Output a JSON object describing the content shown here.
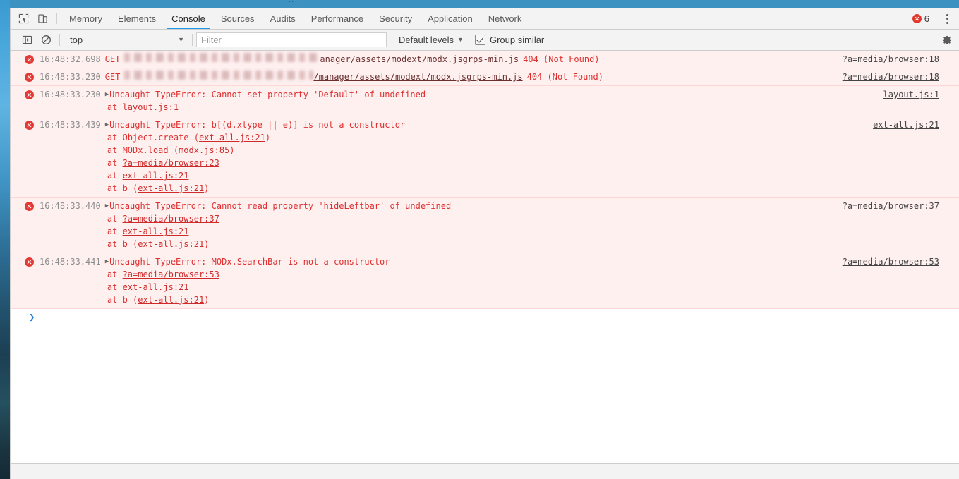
{
  "window": {
    "browser_titlebar_ghost_text": "…",
    "accent_blue": "#1a9bf0",
    "error_red": "#e53935",
    "message_bg": "#fff0f0"
  },
  "tabbar": {
    "icons": [
      {
        "name": "inspect-element-icon",
        "title": "Inspect element"
      },
      {
        "name": "device-toolbar-icon",
        "title": "Toggle device toolbar"
      }
    ],
    "tabs": [
      {
        "label": "Memory",
        "active": false
      },
      {
        "label": "Elements",
        "active": false
      },
      {
        "label": "Console",
        "active": true
      },
      {
        "label": "Sources",
        "active": false
      },
      {
        "label": "Audits",
        "active": false
      },
      {
        "label": "Performance",
        "active": false
      },
      {
        "label": "Security",
        "active": false
      },
      {
        "label": "Application",
        "active": false
      },
      {
        "label": "Network",
        "active": false
      }
    ],
    "error_count": "6",
    "more_menu": "⋮"
  },
  "filterbar": {
    "sidebar_toggle_icon": "console-sidebar-icon",
    "clear_icon": "clear-console-icon",
    "context": "top",
    "context_caret": "▼",
    "filter_placeholder": "Filter",
    "filter_value": "",
    "levels_label": "Default levels",
    "levels_caret": "▼",
    "group_similar_label": "Group similar",
    "group_similar_checked": true,
    "settings_icon": "gear-icon"
  },
  "console": {
    "messages": [
      {
        "id": "msg-1",
        "level": "error",
        "timestamp": "16:48:32.698",
        "expandable": false,
        "method": "GET",
        "url_redacted": true,
        "url_redacted_width": 277,
        "url_tail": "anager/assets/modext/modx.jsgrps-min.js",
        "status": "404 (Not Found)",
        "source_link": "?a=media/browser:18",
        "stack": []
      },
      {
        "id": "msg-2",
        "level": "error",
        "timestamp": "16:48:33.230",
        "expandable": false,
        "method": "GET",
        "url_redacted": true,
        "url_redacted_width": 268,
        "url_tail": "/manager/assets/modext/modx.jsgrps-min.js",
        "status": "404 (Not Found)",
        "source_link": "?a=media/browser:18",
        "stack": []
      },
      {
        "id": "msg-3",
        "level": "error",
        "timestamp": "16:48:33.230",
        "expandable": true,
        "triangle": "▶",
        "text": "Uncaught TypeError: Cannot set property 'Default' of undefined",
        "source_link": "layout.js:1",
        "stack": [
          {
            "prefix": "    at ",
            "link": "layout.js:1",
            "suffix": ""
          }
        ]
      },
      {
        "id": "msg-4",
        "level": "error",
        "timestamp": "16:48:33.439",
        "expandable": true,
        "triangle": "▶",
        "text": "Uncaught TypeError: b[(d.xtype || e)] is not a constructor",
        "source_link": "ext-all.js:21",
        "stack": [
          {
            "prefix": "    at Object.create (",
            "link": "ext-all.js:21",
            "suffix": ")"
          },
          {
            "prefix": "    at MODx.load (",
            "link": "modx.js:85",
            "suffix": ")"
          },
          {
            "prefix": "    at ",
            "link": "?a=media/browser:23",
            "suffix": ""
          },
          {
            "prefix": "    at ",
            "link": "ext-all.js:21",
            "suffix": ""
          },
          {
            "prefix": "    at b (",
            "link": "ext-all.js:21",
            "suffix": ")"
          }
        ]
      },
      {
        "id": "msg-5",
        "level": "error",
        "timestamp": "16:48:33.440",
        "expandable": true,
        "triangle": "▶",
        "text": "Uncaught TypeError: Cannot read property 'hideLeftbar' of undefined",
        "source_link": "?a=media/browser:37",
        "stack": [
          {
            "prefix": "    at ",
            "link": "?a=media/browser:37",
            "suffix": ""
          },
          {
            "prefix": "    at ",
            "link": "ext-all.js:21",
            "suffix": ""
          },
          {
            "prefix": "    at b (",
            "link": "ext-all.js:21",
            "suffix": ")"
          }
        ]
      },
      {
        "id": "msg-6",
        "level": "error",
        "timestamp": "16:48:33.441",
        "expandable": true,
        "triangle": "▶",
        "text": "Uncaught TypeError: MODx.SearchBar is not a constructor",
        "source_link": "?a=media/browser:53",
        "stack": [
          {
            "prefix": "    at ",
            "link": "?a=media/browser:53",
            "suffix": ""
          },
          {
            "prefix": "    at ",
            "link": "ext-all.js:21",
            "suffix": ""
          },
          {
            "prefix": "    at b (",
            "link": "ext-all.js:21",
            "suffix": ")"
          }
        ]
      }
    ],
    "prompt_caret": "❯",
    "prompt_value": ""
  }
}
